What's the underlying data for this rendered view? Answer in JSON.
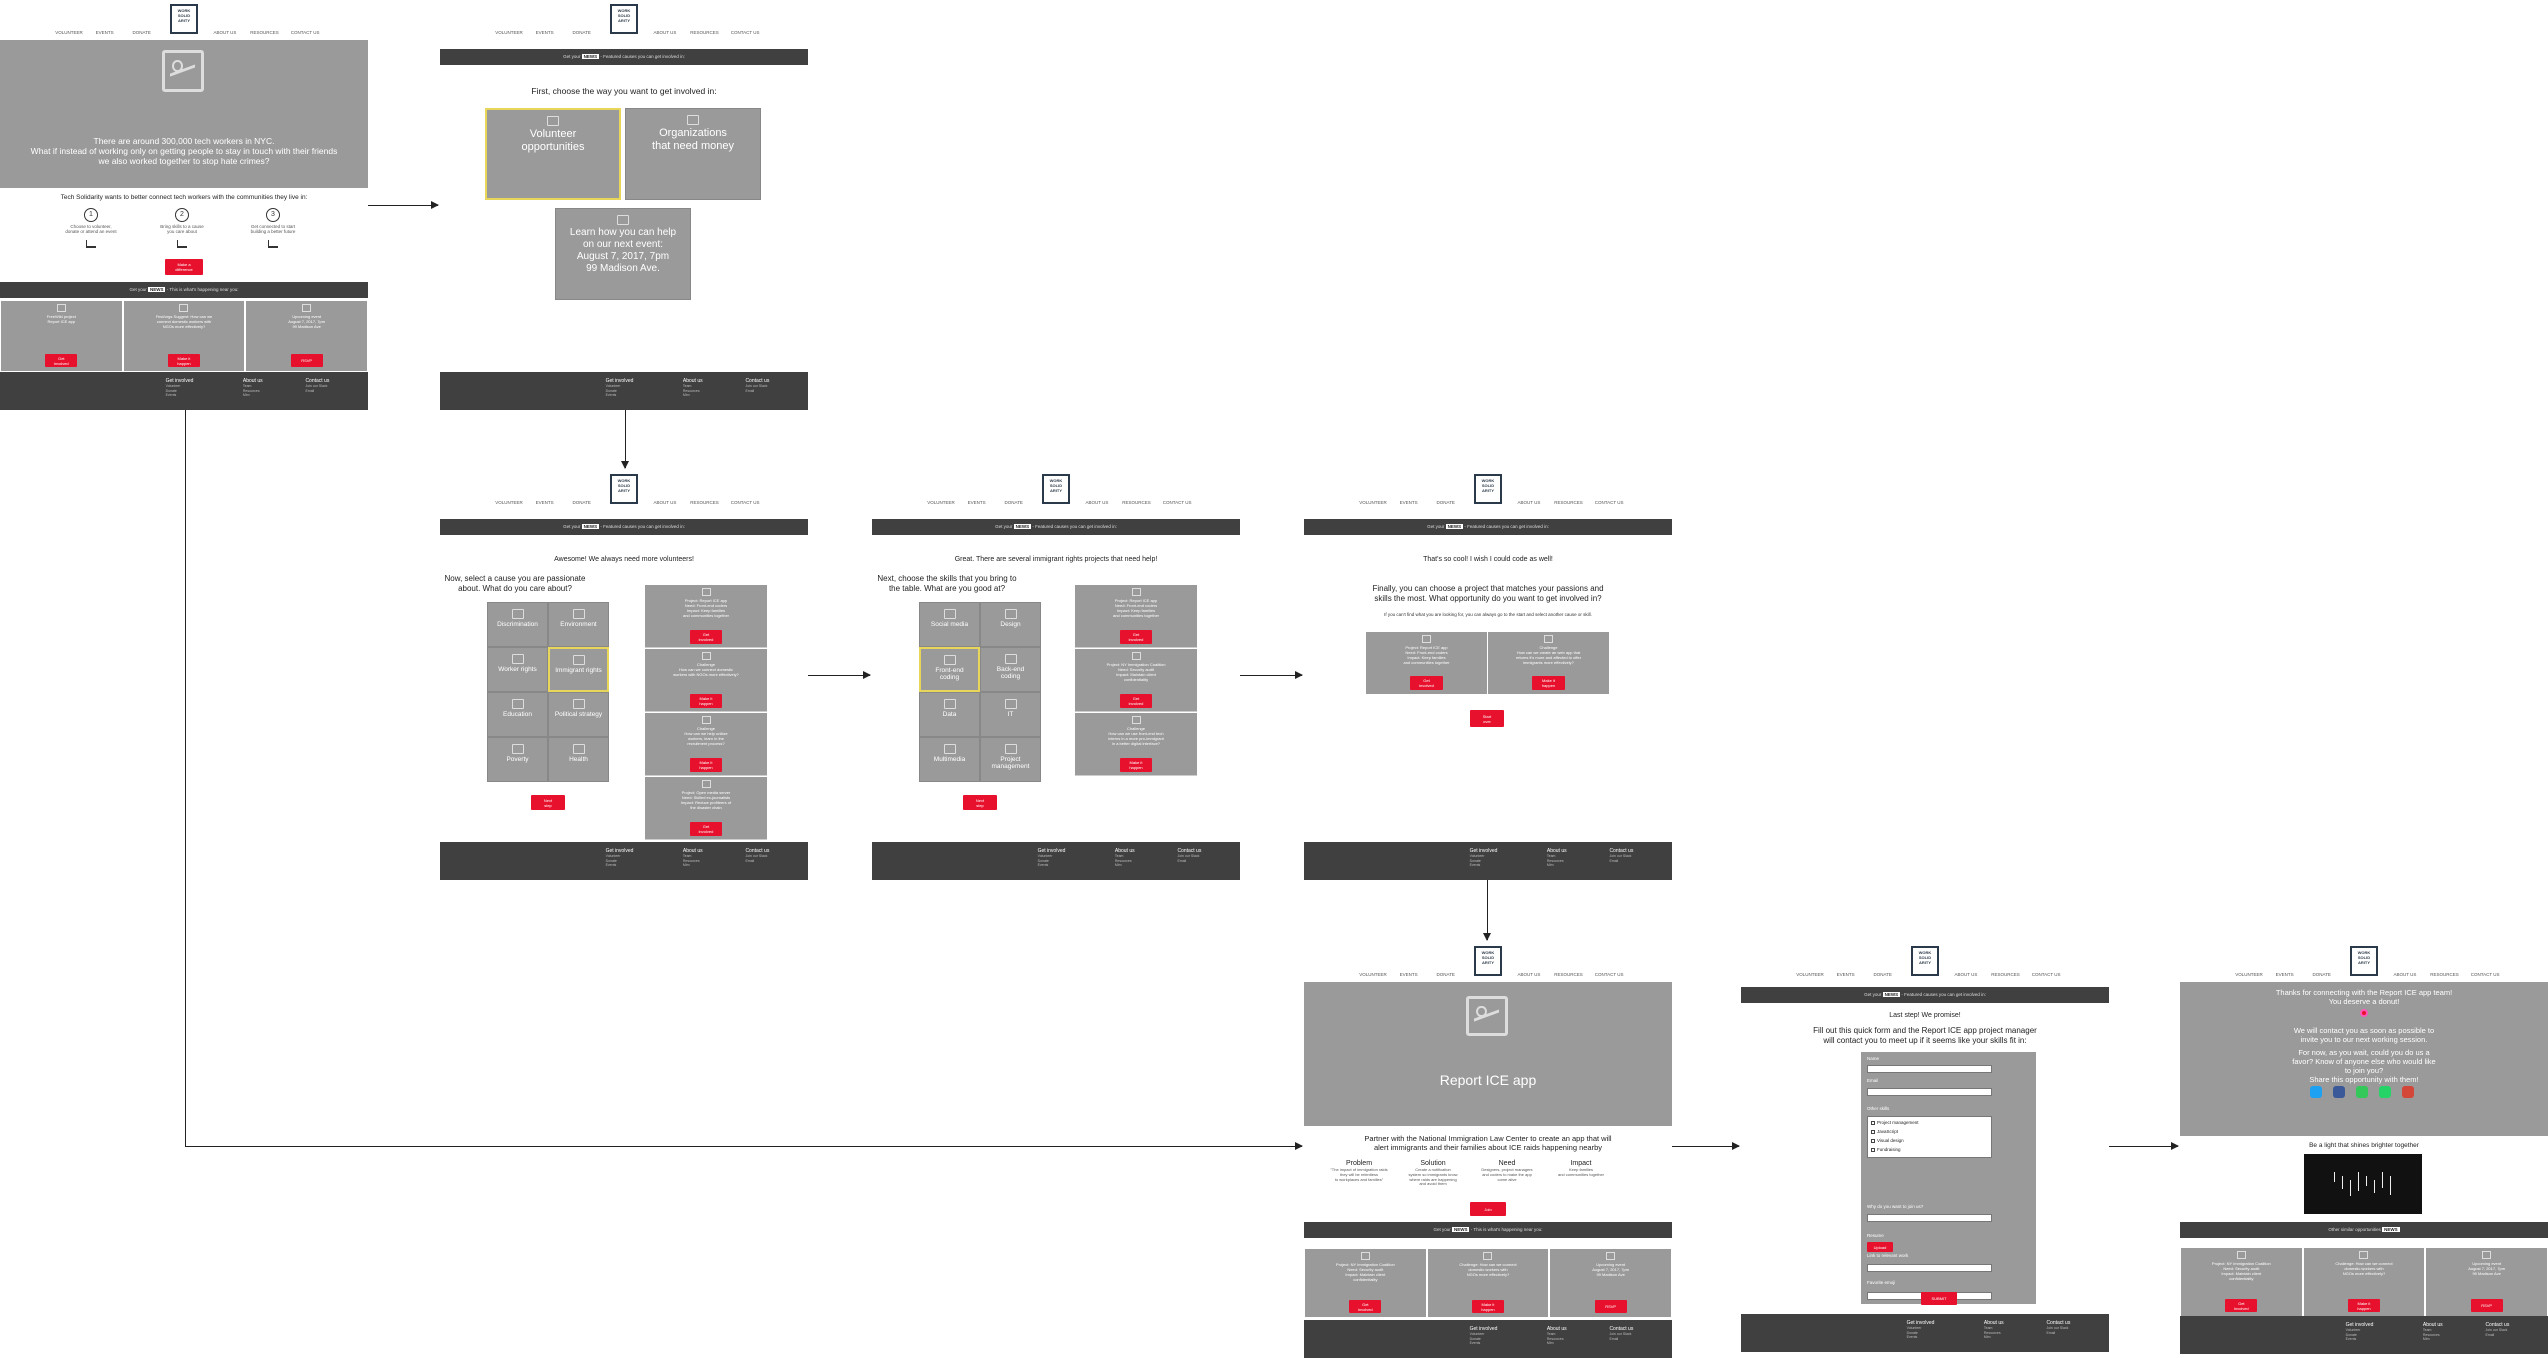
{
  "logo_text": "WORK\nSOLID\nARITY",
  "nav": [
    "VOLUNTEER",
    "EVENTS",
    "DONATE",
    "ABOUT US",
    "RESOURCES",
    "CONTACT US"
  ],
  "bar_main": {
    "pre": "Get your",
    "tag": "NEWS",
    "post": "- This is what's happening near you:"
  },
  "bar_involved": {
    "pre": "Get your",
    "tag": "NEWS",
    "post": "- Featured causes you can get involved in:"
  },
  "bar_other": {
    "pre": "Other similar opportunities",
    "tag": "NEWS"
  },
  "footer": {
    "get_involved": {
      "title": "Get involved",
      "items": [
        "Volunteer",
        "Donate",
        "Events"
      ]
    },
    "about": {
      "title": "About us",
      "items": [
        "Team",
        "Resources",
        "Mim"
      ]
    },
    "contact": {
      "title": "Contact us",
      "items": [
        "Join our Slack",
        "Email"
      ]
    }
  },
  "home": {
    "hero_text": [
      "There are around 300,000 tech workers in NYC.",
      "What if instead of working only on getting people to stay in touch with their friends",
      "we also worked together to stop hate crimes?"
    ],
    "intro": "Tech Solidarity wants to better connect tech workers with the communities they live in:",
    "steps": [
      {
        "n": "1",
        "text": "Choose to volunteer,\ndonate or attend an event"
      },
      {
        "n": "2",
        "text": "Bring skills to a cause\nyou care about"
      },
      {
        "n": "3",
        "text": "Get connected to start\nbuilding a better future"
      }
    ],
    "cta": "Make a\ndifference",
    "cards": [
      {
        "text": "FreeWild project\nReport ICE app",
        "btn": "Get\ninvolved"
      },
      {
        "text": "Find/orgs Suggest: How can we\nconnect domestic workers with\nNGOs more effectively?",
        "btn": "Make it\nhappen"
      },
      {
        "text": "Upcoming event\nAugust 7, 2017, 7pm\n99 Madison Ave",
        "btn": "RSVP"
      }
    ]
  },
  "choose": {
    "heading": "First, choose the way you want to get involved in:",
    "tiles": [
      "Volunteer\nopportunities",
      "Organizations\nthat need money",
      "Learn how you can help\non our next event:\nAugust 7, 2017, 7pm\n99 Madison Ave."
    ]
  },
  "cause": {
    "top": "Awesome! We always need more volunteers!",
    "heading": "Now, select a cause you are passionate\nabout. What do you care about?",
    "tiles": [
      "Discrimination",
      "Environment",
      "Worker rights",
      "Immigrant rights",
      "Education",
      "Political strategy",
      "Poverty",
      "Health"
    ],
    "btn": "Next\nstep",
    "projects": [
      {
        "text": "Project: Report ICE app\nNeed: Front-end coders\nImpact: Keep families\nand communities together",
        "btn": "Get\ninvolved"
      },
      {
        "text": "Challenge\nHow can we connect domestic\nworkers with NGOs more effectively?",
        "btn": "Make it\nhappen"
      },
      {
        "text": "Challenge\nHow can we help unitize\nworkers, learn in the\nrecruitment process?",
        "btn": "Make it\nhappen"
      },
      {
        "text": "Project: Open media server\nNeed: Skilled ex-journalists\nImpact: Reduce profiteers of\nthe disaster chain",
        "btn": "Get\ninvolved"
      }
    ]
  },
  "skills": {
    "top": "Great. There are several immigrant rights projects that need help!",
    "heading": "Next, choose the skills that you bring to\nthe table. What are you good at?",
    "tiles": [
      "Social media",
      "Design",
      "Front-end\ncoding",
      "Back-end\ncoding",
      "Data",
      "IT",
      "Multimedia",
      "Project\nmanagement"
    ],
    "btn": "Next\nstep",
    "projects": [
      {
        "text": "Project: Report ICE app\nNeed: Front-end coders\nImpact: Keep families\nand communities together",
        "btn": "Get\ninvolved"
      },
      {
        "text": "Project: NY Immigration Coalition\nNeed: Security audit\nImpact: Maintain client\nconfidentiality",
        "btn": "Get\ninvolved"
      },
      {
        "text": "Challenge\nHow can we use front-end tech\ninterns in a more pro-immigrant\nin a better digital interface?",
        "btn": "Make it\nhappen"
      }
    ]
  },
  "project": {
    "top": "That's so cool! I wish I could code as well!",
    "heading": "Finally, you can choose a project that matches your passions and\nskills the most. What opportunity do you want to get involved in?",
    "sub": "If you can't find what you are looking for, you can always go to the start and select another cause or skill.",
    "cards": [
      {
        "text": "Project: Report ICE app\nNeed: Front-end coders\nImpact: Keep families\nand communities together",
        "btn": "Get\ninvolved"
      },
      {
        "text": "Challenge\nHow can we create an web app that\nreturns it's more and affected to offer\nimmigrants more effectively?",
        "btn": "Make it\nhappen"
      }
    ],
    "btn": "Start\nover"
  },
  "detail": {
    "title": "Report ICE app",
    "desc": "Partner with the National Immigration Law Center to create an app that will\nalert immigrants and their families about ICE raids happening nearby",
    "cols": [
      {
        "h": "Problem",
        "t": "\"The impact of immigration raids\nthey will be relentless\nto workplaces and families\""
      },
      {
        "h": "Solution",
        "t": "Create a notification\nsystem so immigrants know\nwhere raids are happening\nand avoid them"
      },
      {
        "h": "Need",
        "t": "Designers, project managers\nand coders to make the app\ncome alive"
      },
      {
        "h": "Impact",
        "t": "Keep families\nand communities together"
      }
    ],
    "btn": "Join",
    "cards": [
      {
        "text": "Project: NY Immigration Coalition\nNeed: Security audit\nImpact: Maintain client\nconfidentiality",
        "btn": "Get\ninvolved"
      },
      {
        "text": "Challenge: How can we connect\ndomestic workers with\nNGOs more effectively?",
        "btn": "Make it\nhappen"
      },
      {
        "text": "Upcoming event\nAugust 7, 2017, 7pm\n99 Madison Ave",
        "btn": "RSVP"
      }
    ]
  },
  "form": {
    "top": "Last step! We promise!",
    "heading": "Fill out this quick form and the Report ICE app project manager\nwill contact you to meet up if it seems like your skills fit in:",
    "labels": [
      "Name",
      "Email",
      "Other skills",
      "Why do you want to join us?",
      "Resume",
      "Link to relevant work",
      "Favorite emoji"
    ],
    "skills": [
      "Project management",
      "JavaScript",
      "Visual design",
      "Fundraising"
    ],
    "upload": "Upload",
    "submit": "SUBMIT"
  },
  "thanks": {
    "lines": [
      "Thanks for connecting with the Report ICE app team!",
      "You deserve a donut!",
      "We will contact you as soon as possible to",
      "invite you to our next working session.",
      "For now, as you wait, could you do us a",
      "favor? Know of anyone else who would like",
      "to join you?",
      "Share this opportunity with them!"
    ],
    "social": [
      "twitter-icon",
      "facebook-icon",
      "messages-icon",
      "whatsapp-icon",
      "mail-icon"
    ],
    "caption": "Be a light that shines brighter together",
    "cards": [
      {
        "text": "Project: NY Immigration Coalition\nNeed: Security audit\nImpact: Maintain client\nconfidentiality",
        "btn": "Get\ninvolved"
      },
      {
        "text": "Challenge: How can we connect\ndomestic workers with\nNGOs more effectively?",
        "btn": "Make it\nhappen"
      },
      {
        "text": "Upcoming event\nAugust 7, 2017, 7pm\n99 Madison Ave",
        "btn": "RSVP"
      }
    ]
  },
  "colors": {
    "accent": "#e8112d",
    "gray": "#9a9a9a",
    "dark": "#404040",
    "select": "#e8d65a"
  }
}
